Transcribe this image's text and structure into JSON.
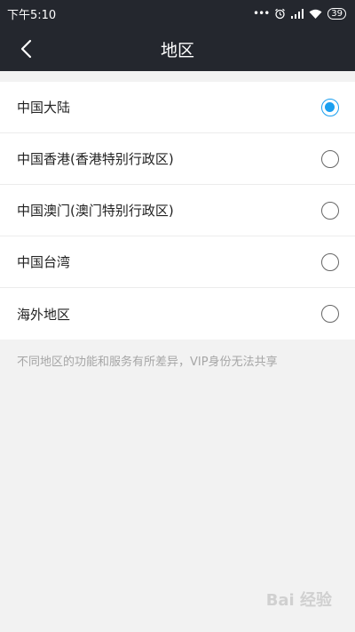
{
  "status_bar": {
    "time": "下午5:10",
    "dots": "•••",
    "battery": "39"
  },
  "header": {
    "title": "地区"
  },
  "regions": [
    {
      "label": "中国大陆",
      "selected": true
    },
    {
      "label": "中国香港(香港特别行政区)",
      "selected": false
    },
    {
      "label": "中国澳门(澳门特别行政区)",
      "selected": false
    },
    {
      "label": "中国台湾",
      "selected": false
    },
    {
      "label": "海外地区",
      "selected": false
    }
  ],
  "note": "不同地区的功能和服务有所差异，VIP身份无法共享",
  "watermark": "Bai 经验",
  "colors": {
    "header_bg": "#24272e",
    "accent": "#1a9ff0"
  }
}
